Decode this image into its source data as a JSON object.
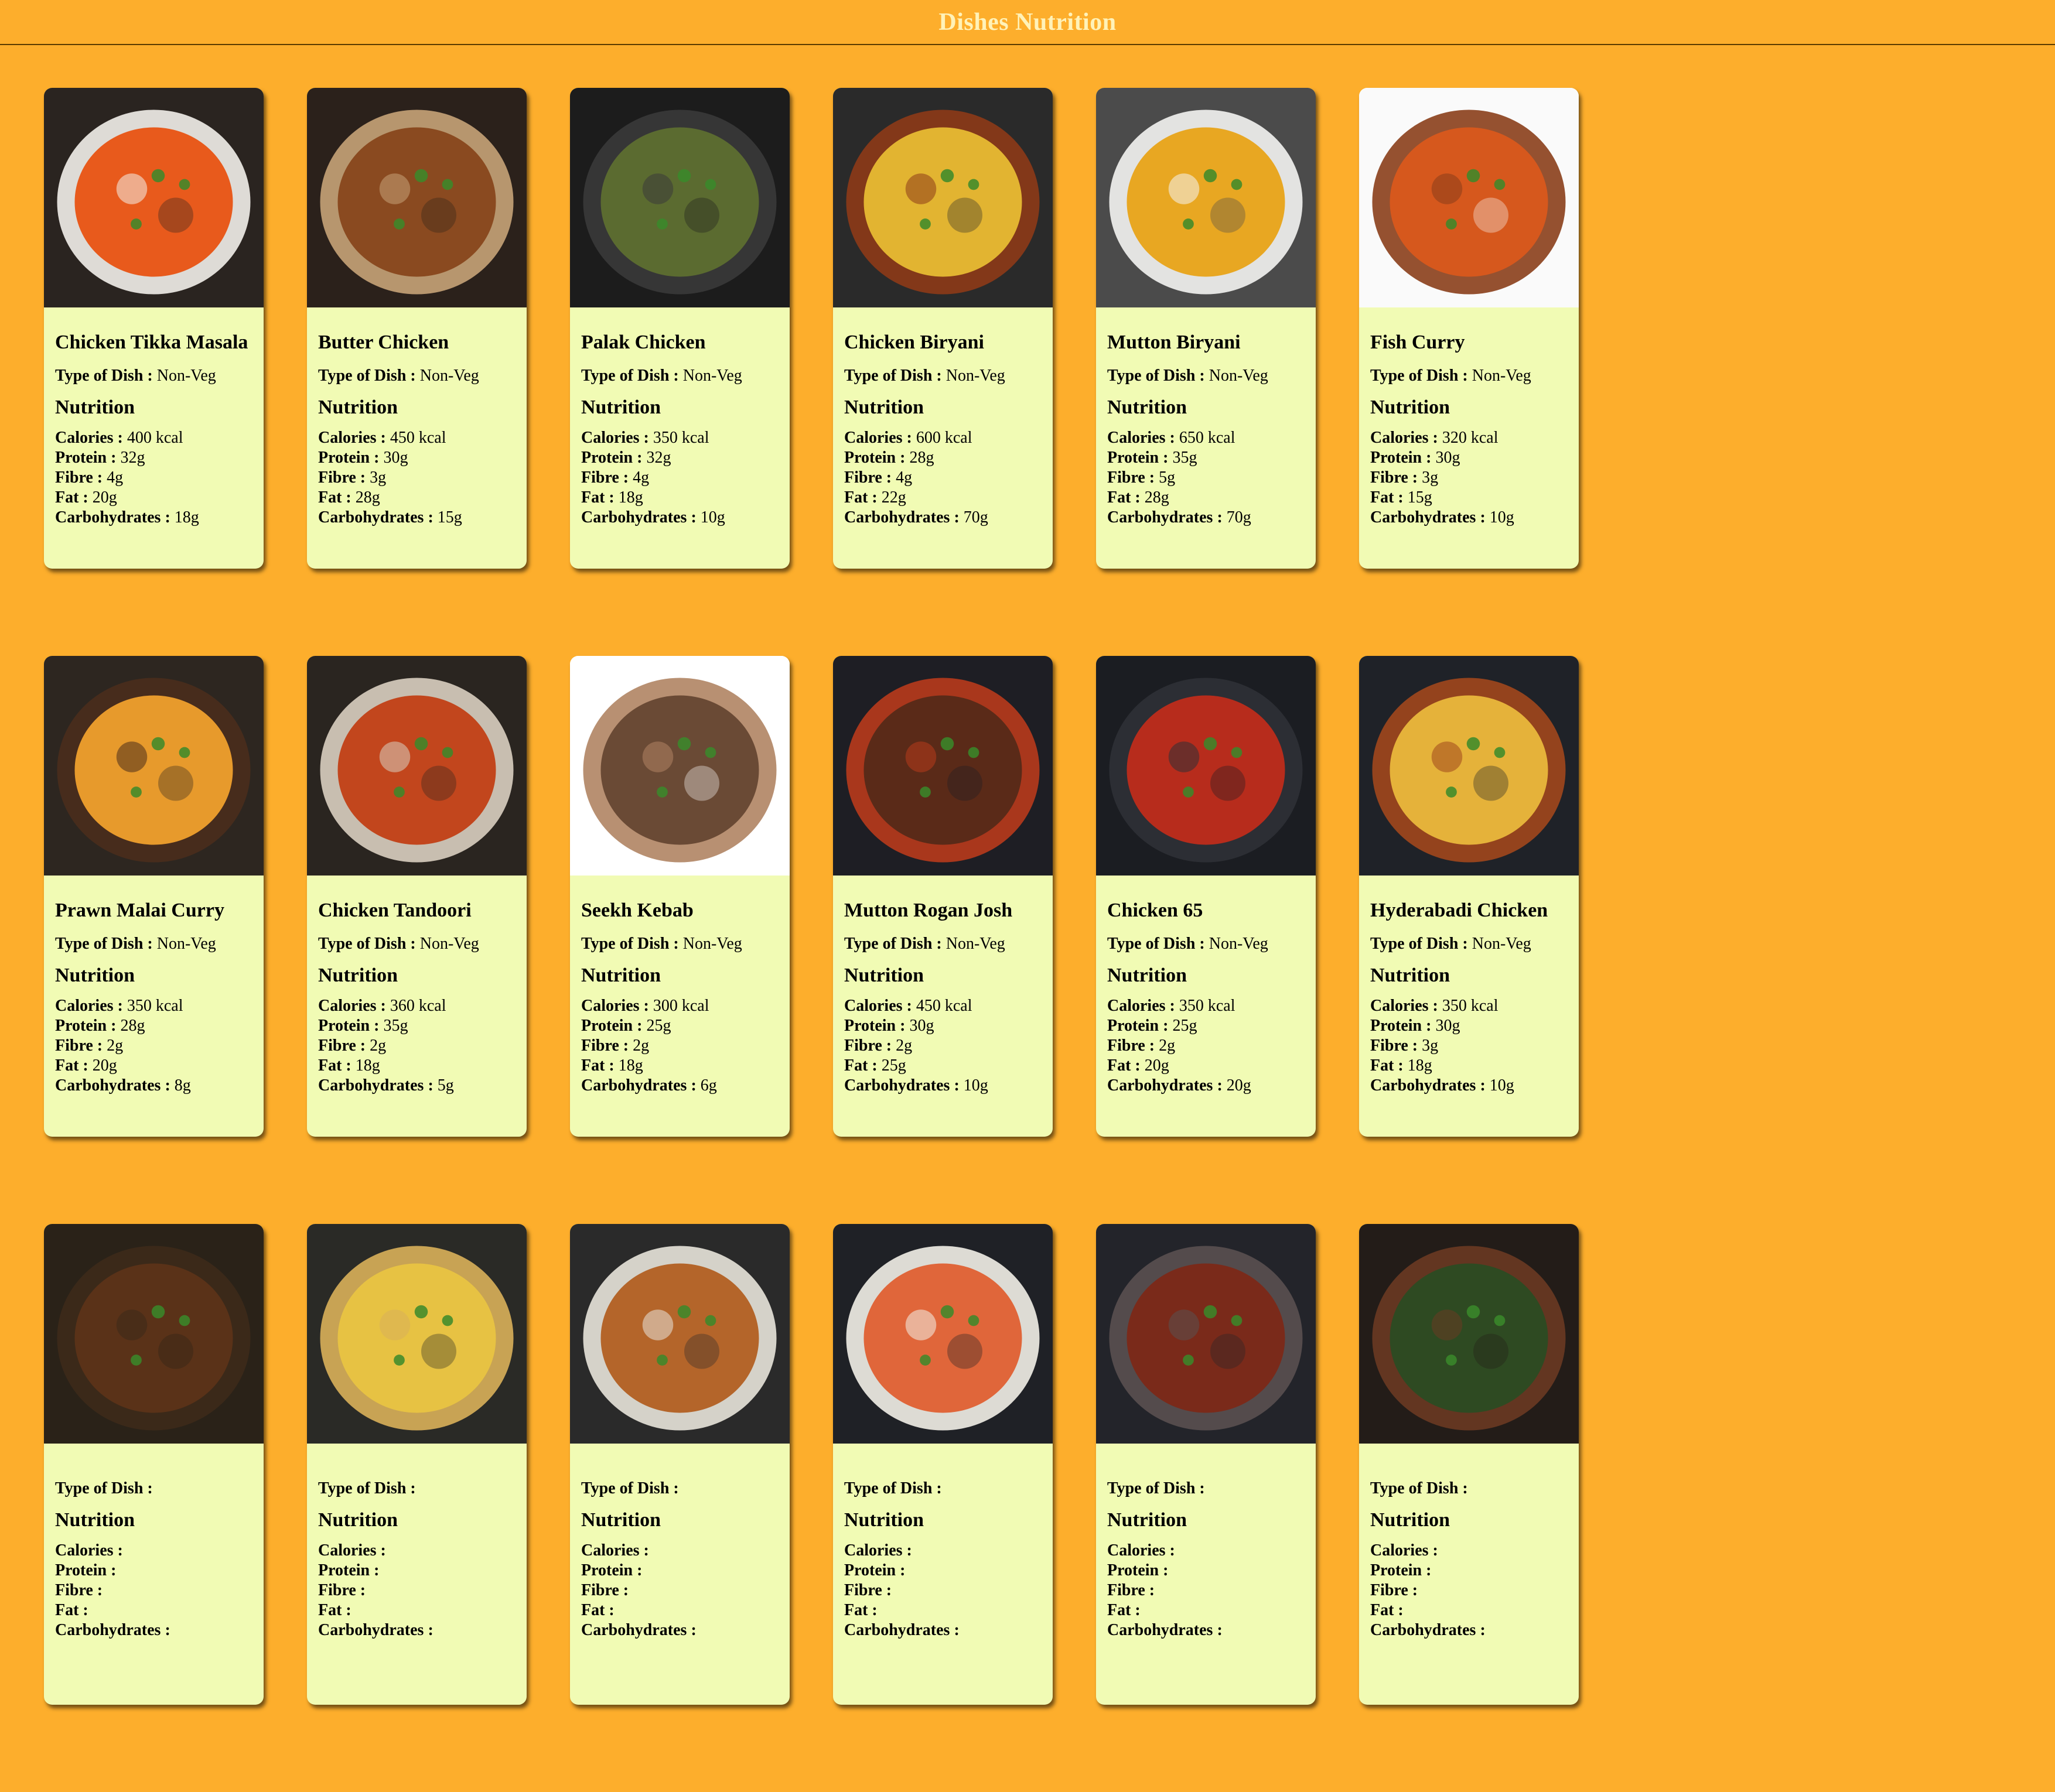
{
  "header": {
    "title": "Dishes Nutrition"
  },
  "labels": {
    "type_of_dish": "Type of Dish :",
    "nutrition": "Nutrition",
    "calories": "Calories :",
    "protein": "Protein :",
    "fibre": "Fibre :",
    "fat": "Fat :",
    "carbohydrates": "Carbohydrates :"
  },
  "dishes": [
    {
      "name": "Chicken Tikka Masala",
      "type": "Non-Veg",
      "calories": "400 kcal",
      "protein": "32g",
      "fibre": "4g",
      "fat": "20g",
      "carbohydrates": "18g",
      "colors": [
        "#2a2420",
        "#e85a1c",
        "#f2f0ea"
      ]
    },
    {
      "name": "Butter Chicken",
      "type": "Non-Veg",
      "calories": "450 kcal",
      "protein": "30g",
      "fibre": "3g",
      "fat": "28g",
      "carbohydrates": "15g",
      "colors": [
        "#2b211b",
        "#8a4a20",
        "#c7a378"
      ]
    },
    {
      "name": "Palak Chicken",
      "type": "Non-Veg",
      "calories": "350 kcal",
      "protein": "32g",
      "fibre": "4g",
      "fat": "18g",
      "carbohydrates": "10g",
      "colors": [
        "#1c1c1c",
        "#5b6b30",
        "#3a3a3a"
      ]
    },
    {
      "name": "Chicken Biryani",
      "type": "Non-Veg",
      "calories": "600 kcal",
      "protein": "28g",
      "fibre": "4g",
      "fat": "22g",
      "carbohydrates": "70g",
      "colors": [
        "#2a2a2a",
        "#e2b431",
        "#8d3a17"
      ]
    },
    {
      "name": "Mutton Biryani",
      "type": "Non-Veg",
      "calories": "650 kcal",
      "protein": "35g",
      "fibre": "5g",
      "fat": "28g",
      "carbohydrates": "70g",
      "colors": [
        "#4b4b4b",
        "#e8a722",
        "#f4f4f2"
      ]
    },
    {
      "name": "Fish Curry",
      "type": "Non-Veg",
      "calories": "320 kcal",
      "protein": "30g",
      "fibre": "3g",
      "fat": "15g",
      "carbohydrates": "10g",
      "colors": [
        "#fafafa",
        "#d6581d",
        "#8a3e1a"
      ]
    },
    {
      "name": "Prawn Malai Curry",
      "type": "Non-Veg",
      "calories": "350 kcal",
      "protein": "28g",
      "fibre": "2g",
      "fat": "20g",
      "carbohydrates": "8g",
      "colors": [
        "#2d2620",
        "#e79a2c",
        "#4a2e1c"
      ]
    },
    {
      "name": "Chicken Tandoori",
      "type": "Non-Veg",
      "calories": "360 kcal",
      "protein": "35g",
      "fibre": "2g",
      "fat": "18g",
      "carbohydrates": "5g",
      "colors": [
        "#2a2520",
        "#c2461d",
        "#d9cfc0"
      ]
    },
    {
      "name": "Seekh Kebab",
      "type": "Non-Veg",
      "calories": "300 kcal",
      "protein": "25g",
      "fibre": "2g",
      "fat": "18g",
      "carbohydrates": "6g",
      "colors": [
        "#ffffff",
        "#6a4a35",
        "#b08463"
      ]
    },
    {
      "name": "Mutton Rogan Josh",
      "type": "Non-Veg",
      "calories": "450 kcal",
      "protein": "30g",
      "fibre": "2g",
      "fat": "25g",
      "carbohydrates": "10g",
      "colors": [
        "#1e1e24",
        "#5a2a18",
        "#b83a1c"
      ]
    },
    {
      "name": "Chicken 65",
      "type": "Non-Veg",
      "calories": "350 kcal",
      "protein": "25g",
      "fibre": "2g",
      "fat": "20g",
      "carbohydrates": "20g",
      "colors": [
        "#1b1d22",
        "#b72c1c",
        "#2f3136"
      ]
    },
    {
      "name": "Hyderabadi Chicken",
      "type": "Non-Veg",
      "calories": "350 kcal",
      "protein": "30g",
      "fibre": "3g",
      "fat": "18g",
      "carbohydrates": "10g",
      "colors": [
        "#1f2228",
        "#e5b23a",
        "#a1471c"
      ]
    },
    {
      "name": "",
      "type": "",
      "calories": "",
      "protein": "",
      "fibre": "",
      "fat": "",
      "carbohydrates": "",
      "colors": [
        "#2a2218",
        "#5a3218",
        "#3d2a1a"
      ]
    },
    {
      "name": "",
      "type": "",
      "calories": "",
      "protein": "",
      "fibre": "",
      "fat": "",
      "carbohydrates": "",
      "colors": [
        "#2a2a26",
        "#e7c243",
        "#d9b05a"
      ]
    },
    {
      "name": "",
      "type": "",
      "calories": "",
      "protein": "",
      "fibre": "",
      "fat": "",
      "carbohydrates": "",
      "colors": [
        "#2a2a2a",
        "#b4652a",
        "#e8e4da"
      ]
    },
    {
      "name": "",
      "type": "",
      "calories": "",
      "protein": "",
      "fibre": "",
      "fat": "",
      "carbohydrates": "",
      "colors": [
        "#1f2126",
        "#e0663a",
        "#f2f0e8"
      ]
    },
    {
      "name": "",
      "type": "",
      "calories": "",
      "protein": "",
      "fibre": "",
      "fat": "",
      "carbohydrates": "",
      "colors": [
        "#23242a",
        "#7a2a1a",
        "#5a5050"
      ]
    },
    {
      "name": "",
      "type": "",
      "calories": "",
      "protein": "",
      "fibre": "",
      "fat": "",
      "carbohydrates": "",
      "colors": [
        "#231c18",
        "#2e4a22",
        "#6a3a22"
      ]
    }
  ]
}
